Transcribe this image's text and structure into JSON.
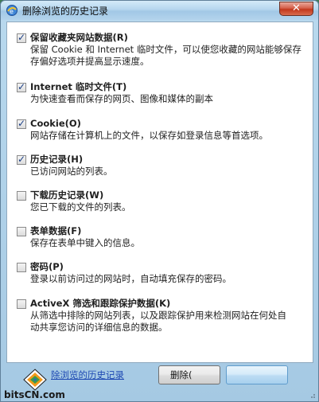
{
  "window": {
    "title": "删除浏览的历史记录",
    "close_symbol": "✕"
  },
  "options": [
    {
      "checked": true,
      "title": "保留收藏夹网站数据(R)",
      "desc": [
        "保留 Cookie 和 Internet 临时文件，可以使您收藏的网站能够保存",
        "存偏好选项并提高显示速度。"
      ]
    },
    {
      "checked": true,
      "title": "Internet 临时文件(T)",
      "desc": [
        "为快速查看而保存的网页、图像和媒体的副本"
      ]
    },
    {
      "checked": true,
      "title": "Cookie(O)",
      "desc": [
        "网站存储在计算机上的文件，以保存如登录信息等首选项。"
      ]
    },
    {
      "checked": true,
      "title": "历史记录(H)",
      "desc": [
        "已访问网站的列表。"
      ]
    },
    {
      "checked": false,
      "title": "下载历史记录(W)",
      "desc": [
        "您已下载的文件的列表。"
      ]
    },
    {
      "checked": false,
      "title": "表单数据(F)",
      "desc": [
        "保存在表单中键入的信息。"
      ]
    },
    {
      "checked": false,
      "title": "密码(P)",
      "desc": [
        "登录以前访问过的网站时，自动填充保存的密码。"
      ]
    },
    {
      "checked": false,
      "title": "ActiveX 筛选和跟踪保护数据(K)",
      "desc": [
        "从筛选中排除的网站列表，以及跟踪保护用来检测网站在何处自",
        "动共享您访问的详细信息的数据。"
      ]
    }
  ],
  "footer": {
    "about_link": "除浏览的历史记录",
    "delete_label": "删除(",
    "cancel_label": ""
  },
  "watermark": {
    "text": "bitsCN.com"
  },
  "colors": {
    "link": "#1e49b3",
    "close_button": "#c2381c",
    "titlebar": "#b5d6ee"
  }
}
